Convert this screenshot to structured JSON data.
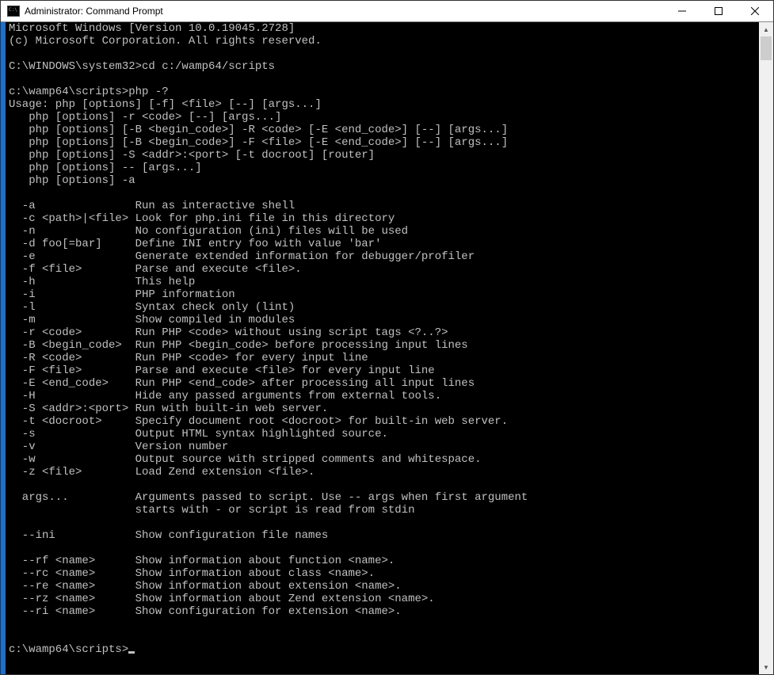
{
  "window": {
    "title": "Administrator: Command Prompt"
  },
  "console": {
    "lines": [
      "Microsoft Windows [Version 10.0.19045.2728]",
      "(c) Microsoft Corporation. All rights reserved.",
      "",
      "C:\\WINDOWS\\system32>cd c:/wamp64/scripts",
      "",
      "c:\\wamp64\\scripts>php -?",
      "Usage: php [options] [-f] <file> [--] [args...]",
      "   php [options] -r <code> [--] [args...]",
      "   php [options] [-B <begin_code>] -R <code> [-E <end_code>] [--] [args...]",
      "   php [options] [-B <begin_code>] -F <file> [-E <end_code>] [--] [args...]",
      "   php [options] -S <addr>:<port> [-t docroot] [router]",
      "   php [options] -- [args...]",
      "   php [options] -a",
      "",
      "  -a               Run as interactive shell",
      "  -c <path>|<file> Look for php.ini file in this directory",
      "  -n               No configuration (ini) files will be used",
      "  -d foo[=bar]     Define INI entry foo with value 'bar'",
      "  -e               Generate extended information for debugger/profiler",
      "  -f <file>        Parse and execute <file>.",
      "  -h               This help",
      "  -i               PHP information",
      "  -l               Syntax check only (lint)",
      "  -m               Show compiled in modules",
      "  -r <code>        Run PHP <code> without using script tags <?..?>",
      "  -B <begin_code>  Run PHP <begin_code> before processing input lines",
      "  -R <code>        Run PHP <code> for every input line",
      "  -F <file>        Parse and execute <file> for every input line",
      "  -E <end_code>    Run PHP <end_code> after processing all input lines",
      "  -H               Hide any passed arguments from external tools.",
      "  -S <addr>:<port> Run with built-in web server.",
      "  -t <docroot>     Specify document root <docroot> for built-in web server.",
      "  -s               Output HTML syntax highlighted source.",
      "  -v               Version number",
      "  -w               Output source with stripped comments and whitespace.",
      "  -z <file>        Load Zend extension <file>.",
      "",
      "  args...          Arguments passed to script. Use -- args when first argument",
      "                   starts with - or script is read from stdin",
      "",
      "  --ini            Show configuration file names",
      "",
      "  --rf <name>      Show information about function <name>.",
      "  --rc <name>      Show information about class <name>.",
      "  --re <name>      Show information about extension <name>.",
      "  --rz <name>      Show information about Zend extension <name>.",
      "  --ri <name>      Show configuration for extension <name>.",
      "",
      ""
    ],
    "prompt": "c:\\wamp64\\scripts>"
  }
}
